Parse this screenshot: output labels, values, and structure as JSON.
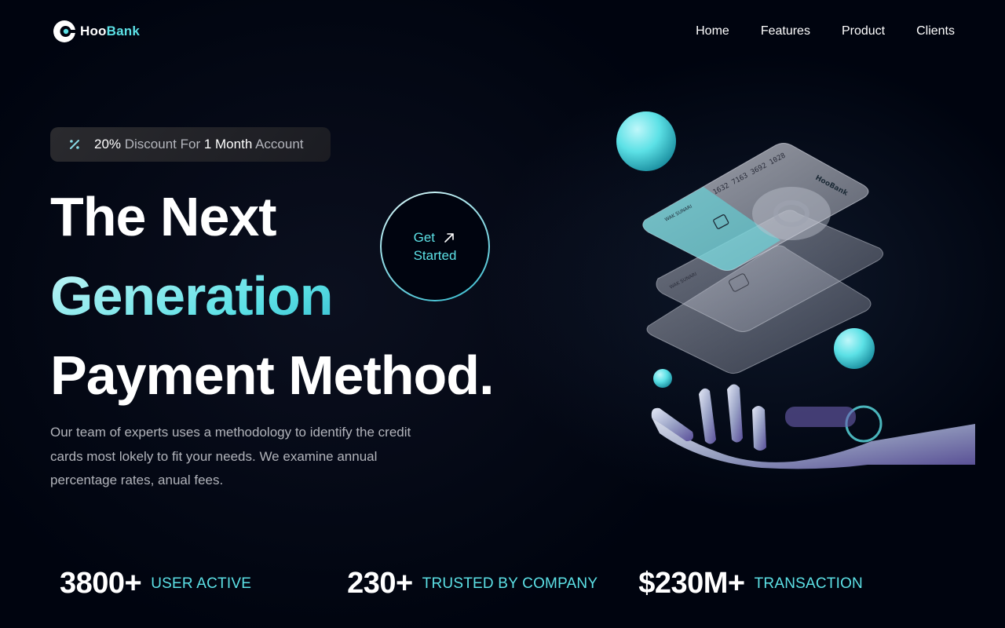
{
  "brand": {
    "name_part1": "Hoo",
    "name_part2": "Bank",
    "accent": "#5ce1e6"
  },
  "nav": {
    "items": [
      "Home",
      "Features",
      "Product",
      "Clients"
    ]
  },
  "badge": {
    "percent": "20%",
    "text1": " Discount For ",
    "duration": "1 Month",
    "text2": " Account",
    "icon": "discount-icon"
  },
  "hero": {
    "line1": "The Next",
    "line2": "Generation",
    "line3": "Payment Method.",
    "description": "Our team of experts uses a methodology to identify the credit cards most lokely to fit your needs. We examine annual percentage rates, anual fees."
  },
  "cta": {
    "line1": "Get",
    "line2": "Started",
    "icon": "arrow-up-right-icon"
  },
  "card": {
    "number": "1632 7163 3692 1028",
    "holder": "WAK SUNARI",
    "brand": "HooBank"
  },
  "stats": [
    {
      "value": "3800+",
      "label": "USER ACTIVE"
    },
    {
      "value": "230+",
      "label": "TRUSTED BY COMPANY"
    },
    {
      "value": "$230M+",
      "label": "TRANSACTION"
    }
  ]
}
